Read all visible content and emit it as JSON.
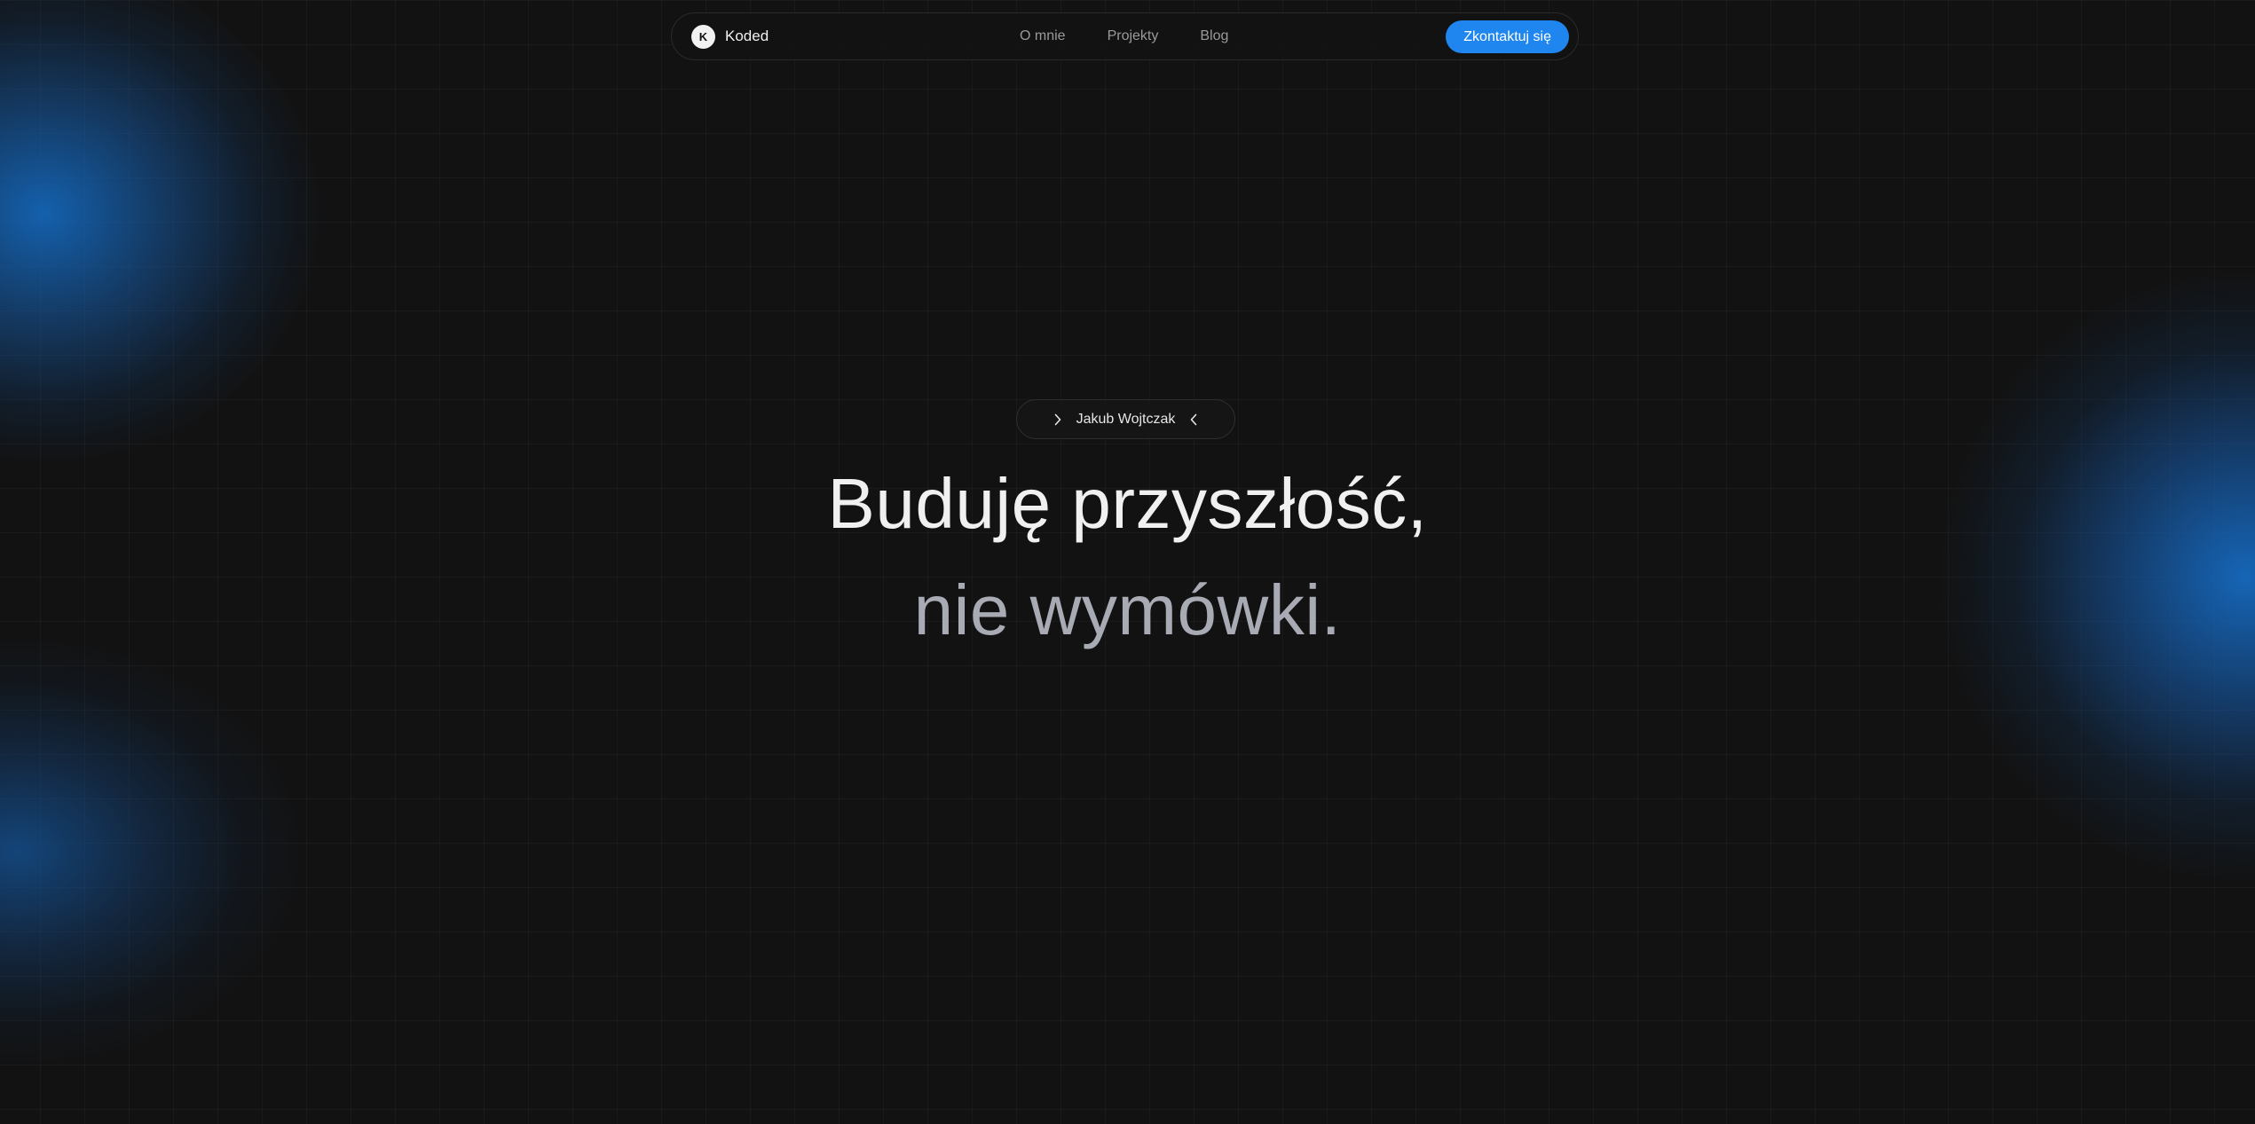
{
  "navbar": {
    "brand_initial": "K",
    "brand_name": "Koded",
    "links": [
      {
        "label": "O mnie"
      },
      {
        "label": "Projekty"
      },
      {
        "label": "Blog"
      }
    ],
    "cta_label": "Zkontaktuj się"
  },
  "hero": {
    "name_badge": "Jakub Wojtczak",
    "headline_line1": "Buduję przyszłość,",
    "headline_line2": "nie wymówki."
  },
  "colors": {
    "background": "#121212",
    "accent": "#1e86ee",
    "glow": "#1a6fc4",
    "muted_text": "#a9abb4"
  },
  "icons": {
    "badge_left": "chevron-right-icon",
    "badge_right": "chevron-left-icon"
  }
}
